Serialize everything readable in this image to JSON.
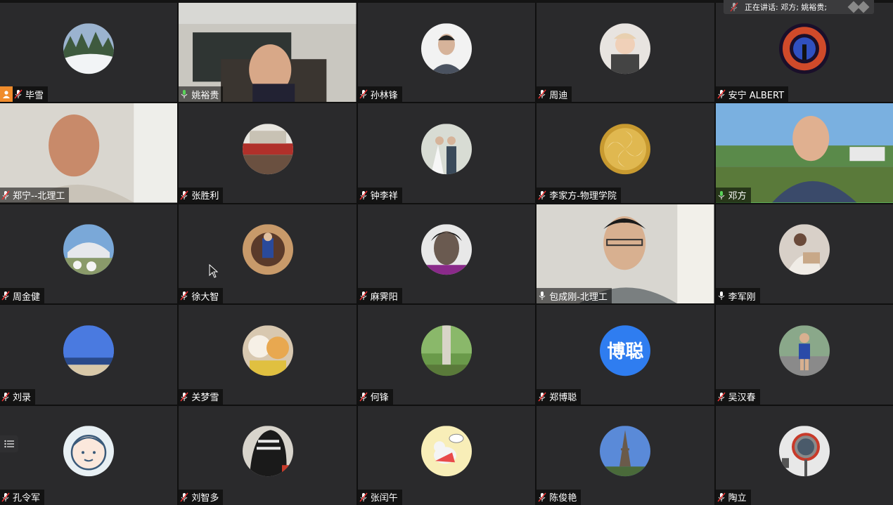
{
  "speaking_banner": {
    "text": "正在讲话: 邓方; 姚裕贵;"
  },
  "participants": [
    {
      "name": "毕雪",
      "host": true
    },
    {
      "name": "姚裕贵"
    },
    {
      "name": "孙林锋"
    },
    {
      "name": "周迪"
    },
    {
      "name": "安宁 ALBERT"
    },
    {
      "name": "郑宁--北理工"
    },
    {
      "name": "张胜利"
    },
    {
      "name": "钟李祥"
    },
    {
      "name": "李家方-物理学院"
    },
    {
      "name": "邓方"
    },
    {
      "name": "周金健"
    },
    {
      "name": "徐大智"
    },
    {
      "name": "麻霁阳"
    },
    {
      "name": "包成刚-北理工"
    },
    {
      "name": "李军刚"
    },
    {
      "name": "刘录"
    },
    {
      "name": "关梦雪"
    },
    {
      "name": "何锋"
    },
    {
      "name": "郑博聪",
      "avatar_text": "博聪"
    },
    {
      "name": "吴汉春"
    },
    {
      "name": "孔令军"
    },
    {
      "name": "刘智多"
    },
    {
      "name": "张闰午"
    },
    {
      "name": "陈俊艳"
    },
    {
      "name": "陶立"
    }
  ],
  "colors": {
    "active_speaker_border": "#5ad35a",
    "host_badge": "#f08c2c",
    "avatar_text_bg": "#2f7df0"
  }
}
